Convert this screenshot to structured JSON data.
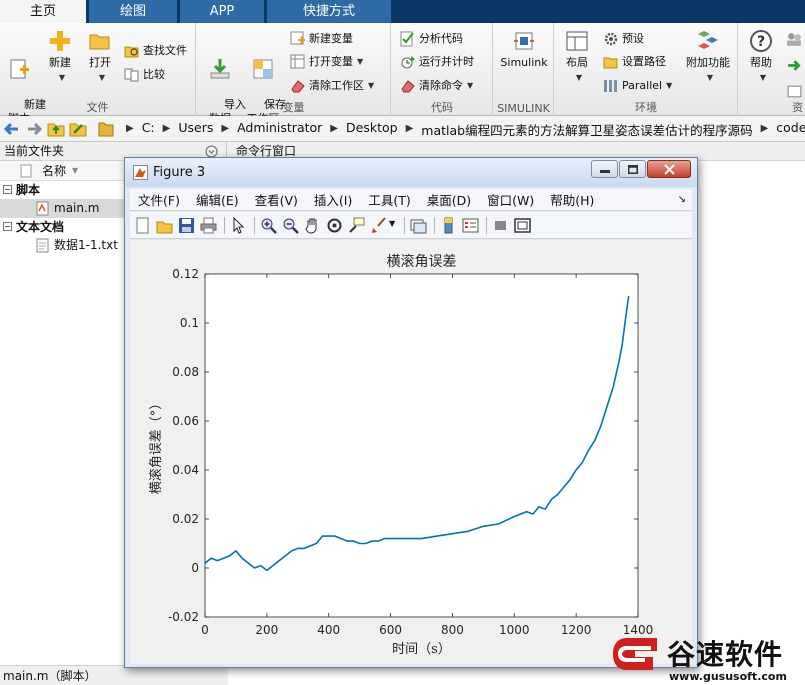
{
  "tabs": [
    {
      "label": "主页",
      "active": true
    },
    {
      "label": "绘图",
      "active": false
    },
    {
      "label": "APP",
      "active": false
    },
    {
      "label": "快捷方式",
      "active": false
    }
  ],
  "ribbon": {
    "file": {
      "section_label": "文件",
      "new_script": "新建\n脚本",
      "new": "新建",
      "open": "打开",
      "find_files": "查找文件",
      "compare": "比较"
    },
    "variable": {
      "section_label": "变量",
      "import_data": "导入\n数据",
      "save_workspace": "保存\n工作区",
      "new_variable": "新建变量",
      "open_variable": "打开变量",
      "clear_workspace": "清除工作区"
    },
    "code": {
      "section_label": "代码",
      "analyze_code": "分析代码",
      "run_and_time": "运行并计时",
      "clear_commands": "清除命令"
    },
    "simulink": {
      "section_label": "SIMULINK",
      "simulink": "Simulink"
    },
    "environment": {
      "section_label": "环境",
      "layout": "布局",
      "preferences": "预设",
      "set_path": "设置路径",
      "parallel": "Parallel",
      "addons": "附加功能",
      "help": "帮助"
    },
    "resources": {
      "section_label": "资"
    }
  },
  "address": {
    "crumbs": [
      "C:",
      "Users",
      "Administrator",
      "Desktop",
      "matlab编程四元素的方法解算卫星姿态误差估计的程序源码",
      "code"
    ]
  },
  "left_panel": {
    "title": "当前文件夹",
    "col_name": "名称",
    "groups": [
      {
        "label": "脚本",
        "files": [
          {
            "name": "main.m",
            "selected": true
          }
        ]
      },
      {
        "label": "文本文档",
        "files": [
          {
            "name": "数据1-1.txt",
            "selected": false
          }
        ]
      }
    ],
    "status": "main.m（脚本）"
  },
  "command_window": {
    "title": "命令行窗口"
  },
  "figure": {
    "title": "Figure 3",
    "menu": [
      "文件(F)",
      "编辑(E)",
      "查看(V)",
      "插入(I)",
      "工具(T)",
      "桌面(D)",
      "窗口(W)",
      "帮助(H)"
    ]
  },
  "chart_data": {
    "type": "line",
    "title": "横滚角误差",
    "xlabel": "时间（s）",
    "ylabel": "横滚角误差（°）",
    "xlim": [
      0,
      1400
    ],
    "ylim": [
      -0.02,
      0.12
    ],
    "xticks": [
      0,
      200,
      400,
      600,
      800,
      1000,
      1200,
      1400
    ],
    "yticks": [
      -0.02,
      0,
      0.02,
      0.04,
      0.06,
      0.08,
      0.1,
      0.12
    ],
    "ytick_labels": [
      "-0.02",
      "0",
      "0.02",
      "0.04",
      "0.06",
      "0.08",
      "0.1",
      "0.12"
    ],
    "grid": false,
    "line_color": "#0072bd",
    "series": [
      {
        "x": [
          0,
          20,
          40,
          60,
          80,
          100,
          120,
          140,
          160,
          180,
          200,
          220,
          240,
          260,
          280,
          300,
          320,
          340,
          360,
          380,
          400,
          420,
          440,
          460,
          480,
          500,
          520,
          540,
          560,
          580,
          600,
          650,
          700,
          750,
          800,
          850,
          900,
          950,
          1000,
          1020,
          1040,
          1060,
          1080,
          1100,
          1120,
          1140,
          1160,
          1180,
          1200,
          1220,
          1240,
          1260,
          1280,
          1300,
          1320,
          1340,
          1350,
          1360,
          1370
        ],
        "values": [
          0.002,
          0.004,
          0.003,
          0.004,
          0.005,
          0.007,
          0.004,
          0.002,
          0.0,
          0.001,
          -0.001,
          0.001,
          0.003,
          0.005,
          0.007,
          0.008,
          0.008,
          0.009,
          0.01,
          0.013,
          0.013,
          0.013,
          0.012,
          0.011,
          0.011,
          0.01,
          0.01,
          0.011,
          0.011,
          0.012,
          0.012,
          0.012,
          0.012,
          0.013,
          0.014,
          0.015,
          0.017,
          0.018,
          0.021,
          0.022,
          0.023,
          0.022,
          0.025,
          0.024,
          0.028,
          0.03,
          0.033,
          0.036,
          0.04,
          0.043,
          0.048,
          0.052,
          0.058,
          0.066,
          0.074,
          0.085,
          0.092,
          0.102,
          0.111
        ]
      }
    ]
  },
  "watermark": {
    "brand": "谷速软件",
    "url": "www.gususoft.com"
  }
}
